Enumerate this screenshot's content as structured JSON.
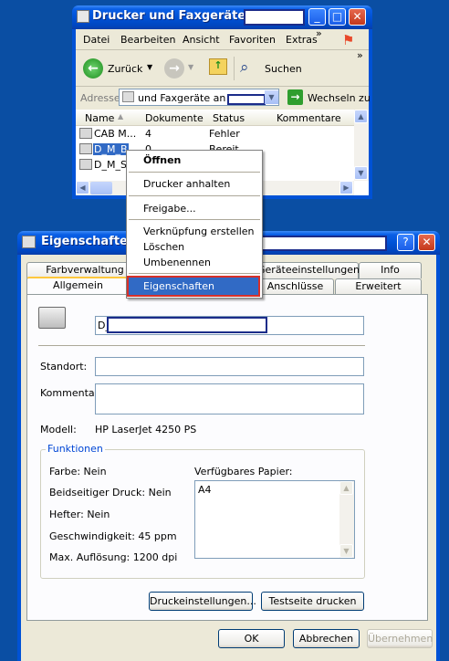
{
  "explorer": {
    "title": "Drucker und Faxgeräte an",
    "menu": [
      "Datei",
      "Bearbeiten",
      "Ansicht",
      "Favoriten",
      "Extras"
    ],
    "menu_more": "»",
    "toolbar": {
      "back": "Zurück",
      "search": "Suchen",
      "more": "»"
    },
    "address": {
      "label": "Adresse",
      "value": "und Faxgeräte an",
      "go": "Wechseln zu"
    },
    "columns": [
      "Name",
      "Dokumente",
      "Status",
      "Kommentare"
    ],
    "rows": [
      {
        "name": "CAB M...",
        "docs": "4",
        "status": "Fehler"
      },
      {
        "name": "D_M_B",
        "docs": "0",
        "status": "Bereit"
      },
      {
        "name": "D_M_S",
        "docs": "",
        "status": ""
      }
    ]
  },
  "context_menu": {
    "open": "Öffnen",
    "pause": "Drucker anhalten",
    "share": "Freigabe...",
    "shortcut": "Verknüpfung erstellen",
    "delete": "Löschen",
    "rename": "Umbenennen",
    "properties": "Eigenschaften"
  },
  "props": {
    "title": "Eigenschaften v",
    "help_btn": "?",
    "tabs_back": [
      "Farbverwaltung",
      "Geräteeinstellungen",
      "Info"
    ],
    "tabs_front": [
      "Allgemein",
      "Anschlüsse",
      "Erweitert"
    ],
    "printer_name": "D_",
    "location_label": "Standort:",
    "location_value": "",
    "comment_label": "Kommentar:",
    "comment_value": "",
    "model_label": "Modell:",
    "model_value": "HP LaserJet 4250 PS",
    "features": {
      "title": "Funktionen",
      "color": "Farbe: Nein",
      "duplex": "Beidseitiger Druck: Nein",
      "staple": "Hefter: Nein",
      "speed": "Geschwindigkeit: 45 ppm",
      "resolution": "Max. Auflösung: 1200 dpi",
      "paper_label": "Verfügbares Papier:",
      "paper_items": [
        "A4"
      ]
    },
    "buttons": {
      "print_settings": "Druckeinstellungen...",
      "test_page": "Testseite drucken",
      "ok": "OK",
      "cancel": "Abbrechen",
      "apply": "Übernehmen"
    }
  }
}
